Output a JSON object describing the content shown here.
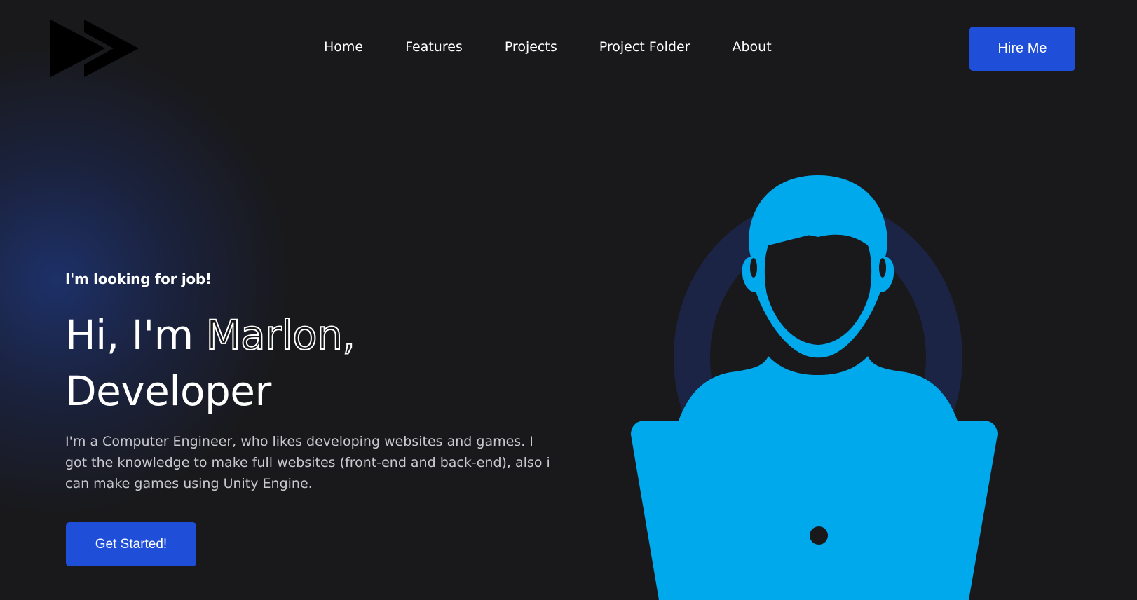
{
  "header": {
    "logo_icon": "fast-forward-icon",
    "nav": [
      {
        "label": "Home"
      },
      {
        "label": "Features"
      },
      {
        "label": "Projects"
      },
      {
        "label": "Project Folder"
      },
      {
        "label": "About"
      }
    ],
    "hire_button_label": "Hire Me"
  },
  "hero": {
    "eyebrow": "I'm looking for job!",
    "headline_part1": "Hi, I'm ",
    "headline_name": "Marlon,",
    "headline_line2": "Developer",
    "description": "I'm a Computer Engineer, who likes developing websites and games. I got the knowledge to make full websites (front-end and back-end), also i can make games using Unity Engine.",
    "cta_label": "Get Started!",
    "illustration_icon": "developer-at-laptop-icon"
  },
  "colors": {
    "background": "#19191b",
    "accent": "#1f4fd8",
    "illustration": "#00a8ec",
    "halo": "#1b2444"
  }
}
